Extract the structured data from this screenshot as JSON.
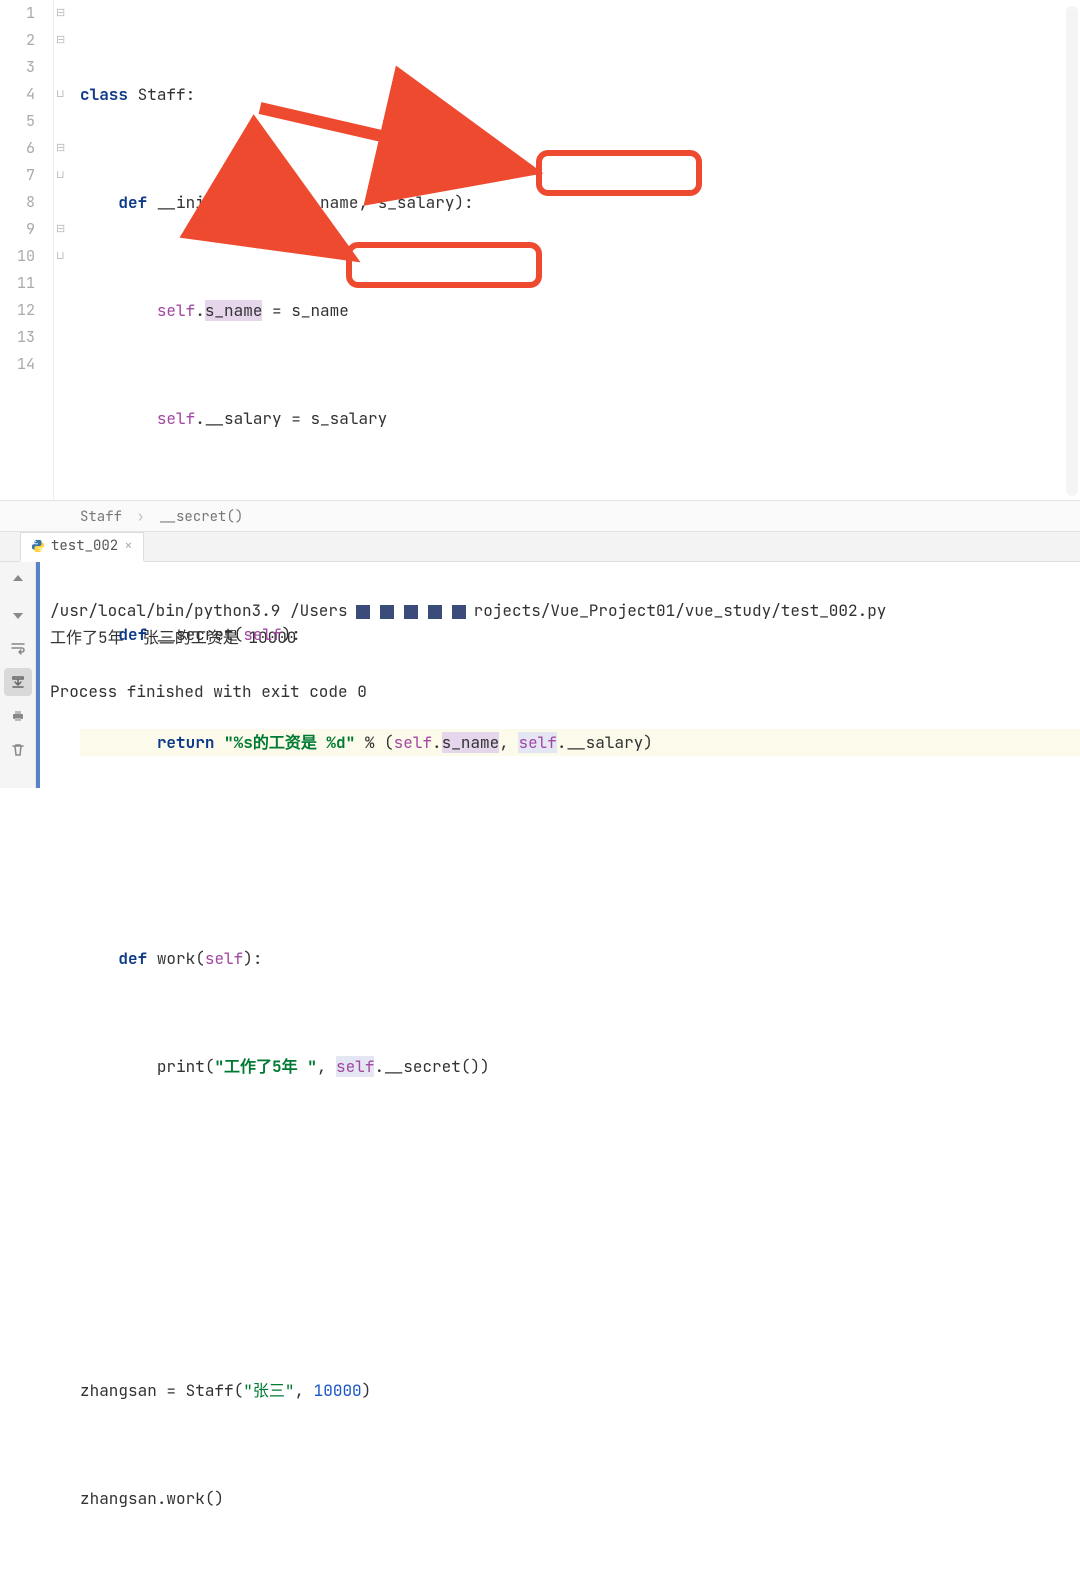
{
  "editor": {
    "line_count": 14,
    "highlighted_line": 7,
    "lines": {
      "l1": {
        "kw_class": "class",
        "cls": "Staff",
        "colon": ":"
      },
      "l2": {
        "kw_def": "def",
        "fn": "__init__",
        "params": "self, s_name, s_salary",
        "self": "self"
      },
      "l3": {
        "self": "self",
        "attr": "s_name",
        "eq": " = ",
        "rhs": "s_name"
      },
      "l4": {
        "self": "self",
        "attr": "__salary",
        "eq": " = ",
        "rhs": "s_salary"
      },
      "l6": {
        "kw_def": "def",
        "fn": "__secret",
        "self": "self"
      },
      "l7": {
        "kw_return": "return",
        "str": "\"%s的工资是 %d\"",
        "pct": " % (",
        "self1": "self",
        "attr1": "s_name",
        "comma": ", ",
        "self2": "self",
        "attr2": "__salary",
        "close": ")"
      },
      "l9": {
        "kw_def": "def",
        "fn": "work",
        "self": "self"
      },
      "l10": {
        "builtin": "print",
        "open": "(",
        "str": "\"工作了5年 \"",
        "comma": ", ",
        "self": "self",
        "call": ".__secret()",
        "close": ")"
      },
      "l13": {
        "var": "zhangsan",
        "eq": " = ",
        "cls": "Staff",
        "open": "(",
        "str": "\"张三\"",
        "comma": ", ",
        "num": "10000",
        "close": ")"
      },
      "l14": {
        "var": "zhangsan",
        "call": ".work()"
      }
    }
  },
  "breadcrumb": {
    "a": "Staff",
    "b": "__secret()"
  },
  "tab": {
    "name": "test_002"
  },
  "console": {
    "path_left": "/usr/local/bin/python3.9 /Users",
    "path_right": "rojects/Vue_Project01/vue_study/test_002.py",
    "out_line": "工作了5年  张三的工资是 10000",
    "exit_line": "Process finished with exit code 0"
  },
  "icons": {
    "up": "up-arrow-icon",
    "down": "down-arrow-icon",
    "wrap": "wrap-icon",
    "scroll": "scroll-to-end-icon",
    "print": "print-icon",
    "trash": "trash-icon",
    "close": "close-icon",
    "python": "python-icon"
  }
}
